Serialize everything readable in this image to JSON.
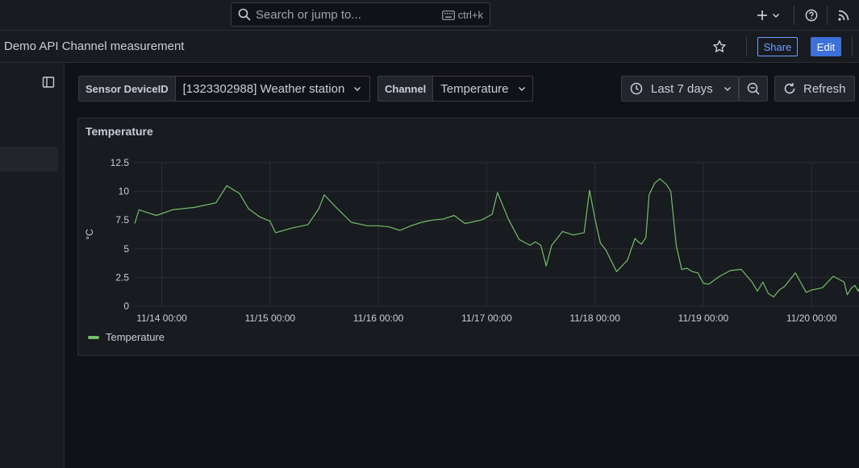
{
  "topbar": {
    "search_placeholder": "Search or jump to...",
    "search_shortcut": "ctrl+k",
    "icons": [
      "search-icon",
      "keyboard-icon",
      "plus-icon",
      "chevron-down-icon",
      "help-icon",
      "rss-icon"
    ]
  },
  "breadcrumb": {
    "title": "Demo API Channel measurement"
  },
  "toolbar": {
    "share_label": "Share",
    "edit_label": "Edit"
  },
  "variables": {
    "sensor": {
      "label": "Sensor DeviceID",
      "value": "[1323302988] Weather station"
    },
    "channel": {
      "label": "Channel",
      "value": "Temperature"
    }
  },
  "time_range": {
    "label": "Last 7 days",
    "refresh_label": "Refresh"
  },
  "colors": {
    "series": "#73bf69",
    "accent": "#3d71d9",
    "share": "#6e9fff"
  },
  "panel": {
    "title": "Temperature",
    "legend": "Temperature"
  },
  "chart_data": {
    "type": "line",
    "title": "Temperature",
    "ylabel": "°C",
    "xlabel": "",
    "ylim": [
      0,
      12.5
    ],
    "yticks": [
      0,
      2.5,
      5,
      7.5,
      10,
      12.5
    ],
    "ytick_labels": [
      "0",
      "2.5",
      "5",
      "7.5",
      "10",
      "12.5"
    ],
    "xlim": [
      -0.25,
      6.49
    ],
    "xticks": [
      0,
      1,
      2,
      3,
      4,
      5,
      6
    ],
    "xtick_labels": [
      "11/14 00:00",
      "11/15 00:00",
      "11/16 00:00",
      "11/17 00:00",
      "11/18 00:00",
      "11/19 00:00",
      "11/20 00:00"
    ],
    "grid": true,
    "legend_position": "bottom-left",
    "series": [
      {
        "name": "Temperature",
        "x": [
          -0.25,
          -0.21,
          -0.15,
          -0.05,
          0.1,
          0.3,
          0.5,
          0.6,
          0.72,
          0.8,
          0.9,
          1.0,
          1.05,
          1.2,
          1.35,
          1.45,
          1.5,
          1.6,
          1.75,
          1.9,
          2.0,
          2.1,
          2.2,
          2.3,
          2.4,
          2.5,
          2.6,
          2.7,
          2.8,
          2.95,
          3.05,
          3.1,
          3.2,
          3.3,
          3.4,
          3.45,
          3.5,
          3.55,
          3.6,
          3.7,
          3.8,
          3.9,
          3.95,
          4.0,
          4.05,
          4.1,
          4.2,
          4.3,
          4.37,
          4.4,
          4.43,
          4.47,
          4.5,
          4.55,
          4.6,
          4.66,
          4.7,
          4.75,
          4.8,
          4.85,
          4.9,
          4.95,
          5.0,
          5.05,
          5.15,
          5.25,
          5.35,
          5.45,
          5.5,
          5.55,
          5.6,
          5.65,
          5.7,
          5.75,
          5.85,
          5.95,
          6.0,
          6.1,
          6.2,
          6.3,
          6.33,
          6.37,
          6.4,
          6.43,
          6.46,
          6.49
        ],
        "values": [
          7.2,
          8.4,
          8.2,
          7.9,
          8.4,
          8.6,
          9.0,
          10.5,
          9.8,
          8.5,
          7.8,
          7.4,
          6.4,
          6.8,
          7.1,
          8.5,
          9.7,
          8.7,
          7.3,
          7.0,
          7.0,
          6.9,
          6.6,
          7.0,
          7.3,
          7.5,
          7.6,
          7.9,
          7.2,
          7.5,
          8.0,
          9.9,
          7.6,
          5.8,
          5.3,
          5.6,
          5.3,
          3.5,
          5.3,
          6.5,
          6.2,
          6.4,
          10.1,
          7.6,
          5.5,
          4.9,
          3.0,
          4.0,
          5.9,
          5.6,
          5.4,
          6.0,
          9.7,
          10.7,
          11.1,
          10.6,
          10.0,
          5.3,
          3.2,
          3.3,
          3.0,
          2.9,
          2.0,
          1.9,
          2.6,
          3.1,
          3.2,
          2.1,
          1.3,
          2.1,
          1.1,
          0.8,
          1.4,
          1.7,
          2.9,
          1.2,
          1.4,
          1.6,
          2.6,
          2.1,
          1.0,
          1.6,
          1.8,
          1.3,
          2.0,
          1.9
        ]
      }
    ]
  }
}
